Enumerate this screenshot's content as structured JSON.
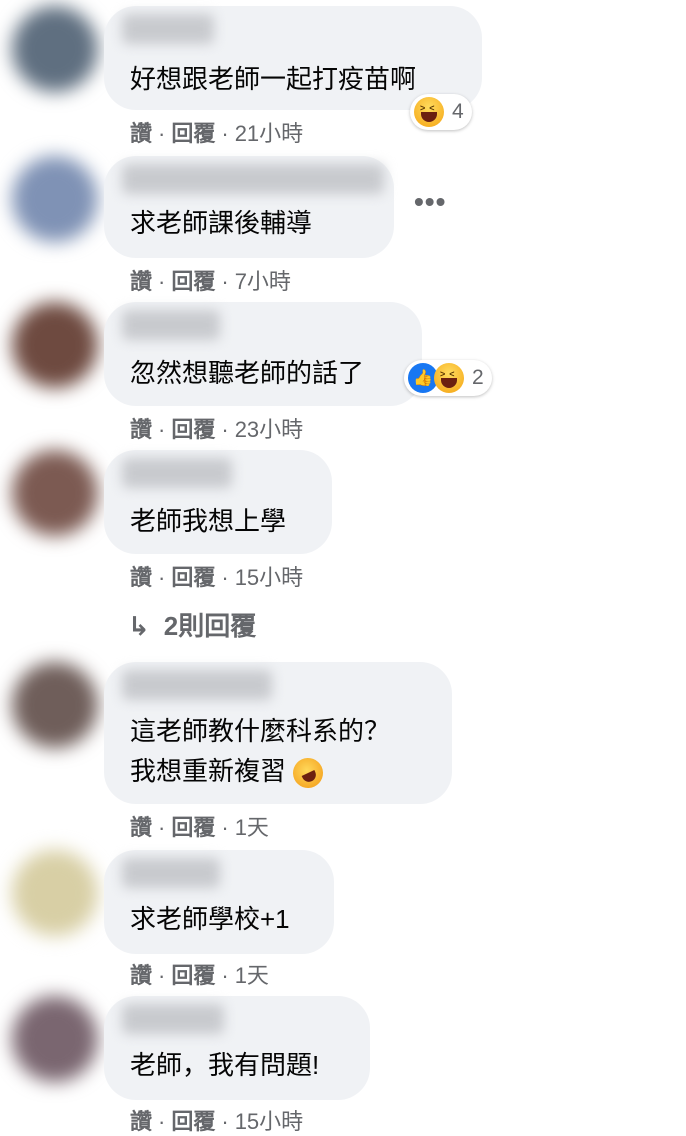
{
  "comments": [
    {
      "text": "好想跟老師一起打疫苗啊",
      "like_label": "讚",
      "reply_label": "回覆",
      "time": "21小時",
      "reaction_count": "4"
    },
    {
      "text": "求老師課後輔導",
      "like_label": "讚",
      "reply_label": "回覆",
      "time": "7小時"
    },
    {
      "text": "忽然想聽老師的話了",
      "like_label": "讚",
      "reply_label": "回覆",
      "time": "23小時",
      "reaction_count": "2"
    },
    {
      "text": "老師我想上學",
      "like_label": "讚",
      "reply_label": "回覆",
      "time": "15小時"
    },
    {
      "text_line1": "這老師教什麼科系的？",
      "text_line2": "我想重新複習",
      "like_label": "讚",
      "reply_label": "回覆",
      "time": "1天"
    },
    {
      "text": "求老師學校+1",
      "like_label": "讚",
      "reply_label": "回覆",
      "time": "1天"
    },
    {
      "text": "老師，我有問題!",
      "like_label": "讚",
      "reply_label": "回覆",
      "time": "15小時"
    }
  ],
  "replies_link": {
    "arrow": "↳",
    "label": "2則回覆"
  },
  "more_menu": "•••",
  "separator": "·",
  "icons": {
    "haha": "haha-reaction-icon",
    "like": "like-reaction-icon",
    "rofl": "rolling-on-floor-laughing-emoji"
  },
  "colors": {
    "bubble": "#f0f2f5",
    "meta_text": "#65676b",
    "like_blue": "#1877f2"
  }
}
